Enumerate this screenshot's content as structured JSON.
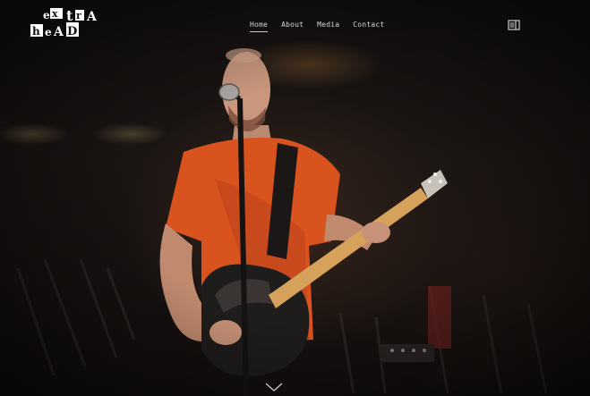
{
  "brand": {
    "logo_text": "extrA heAD"
  },
  "nav": {
    "items": [
      {
        "label": "Home",
        "active": true
      },
      {
        "label": "About",
        "active": false
      },
      {
        "label": "Media",
        "active": false
      },
      {
        "label": "Contact",
        "active": false
      }
    ]
  },
  "icons": {
    "menu": "sidebar-menu-icon",
    "scroll": "chevron-down-icon"
  },
  "colors": {
    "nav_text": "#d9d4cf",
    "shirt": "#d9531f",
    "background": "#141110"
  }
}
